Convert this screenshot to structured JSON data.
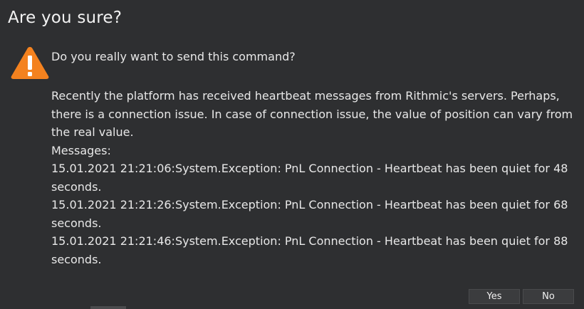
{
  "dialog": {
    "title": "Are you sure?",
    "icon": "warning-triangle-icon",
    "question": "Do you really want to send this command?",
    "paragraph": "Recently the platform has received heartbeat messages from Rithmic's servers. Perhaps, there is a connection issue.  In case of connection issue, the value of position can vary from the real value.",
    "messages_label": "Messages:",
    "messages": [
      "15.01.2021 21:21:06:System.Exception: PnL Connection - Heartbeat has been quiet for 48 seconds.",
      "15.01.2021 21:21:26:System.Exception: PnL Connection - Heartbeat has been quiet for 68 seconds.",
      "15.01.2021 21:21:46:System.Exception: PnL Connection - Heartbeat has been quiet for 88 seconds."
    ],
    "buttons": {
      "yes": "Yes",
      "no": "No"
    }
  },
  "colors": {
    "background": "#2e2f31",
    "text": "#e8e8e8",
    "warning": "#f4821f"
  }
}
